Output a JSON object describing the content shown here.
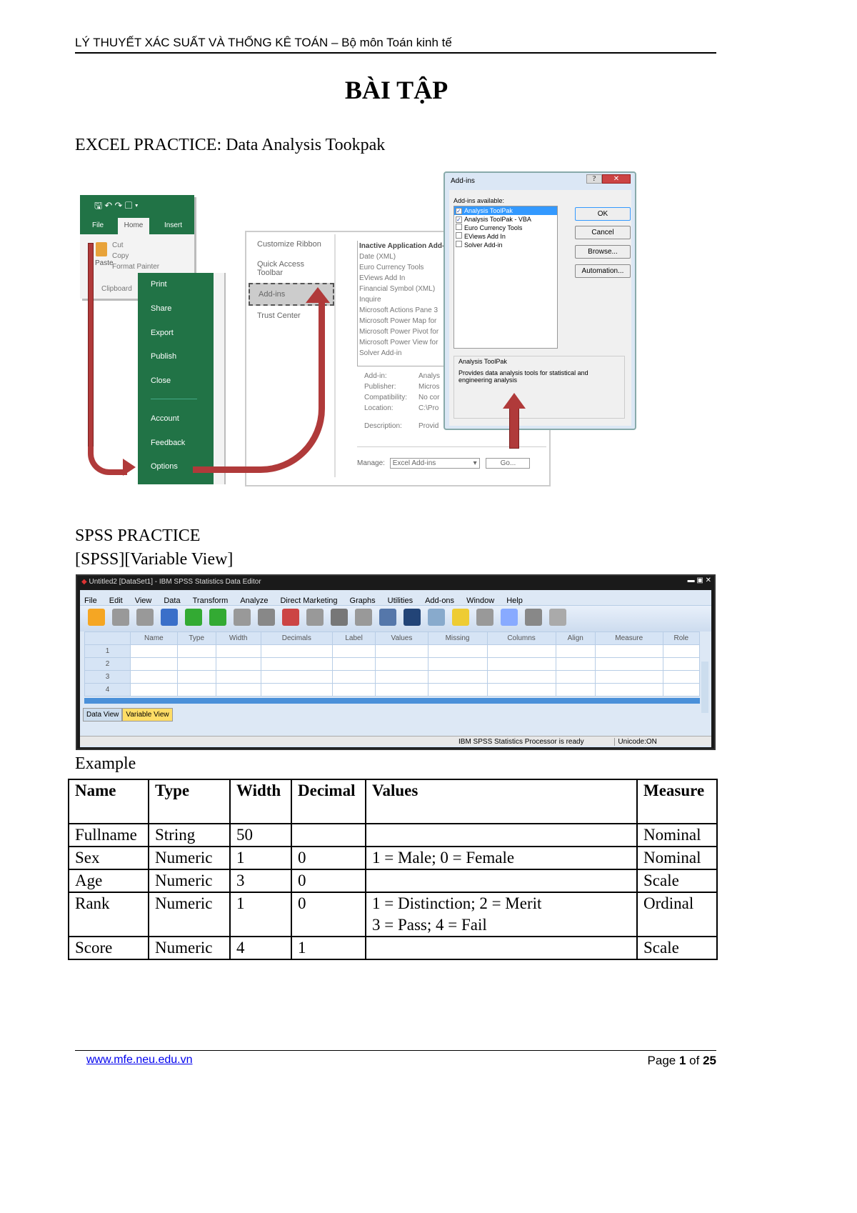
{
  "header": "LÝ THUYẾT XÁC SUẤT VÀ THỐNG KÊ TOÁN – Bộ môn Toán kinh tế",
  "title": "BÀI TẬP",
  "excel_heading": "EXCEL PRACTICE: Data Analysis Tookpak",
  "excel": {
    "tabs": [
      "File",
      "Home",
      "Insert"
    ],
    "ribbon": [
      "Cut",
      "Copy",
      "Format Painter",
      "Clipboard",
      "Paste"
    ],
    "backstage": [
      "Print",
      "Share",
      "Export",
      "Publish",
      "Close",
      "Account",
      "Feedback",
      "Options"
    ],
    "options_nav": [
      "Customize Ribbon",
      "Quick Access Toolbar",
      "Add-ins",
      "Trust Center"
    ],
    "inactive_title": "Inactive Application Add-ins",
    "inactive": [
      "Date (XML)",
      "Euro Currency Tools",
      "EViews Add In",
      "Financial Symbol (XML)",
      "Inquire",
      "Microsoft Actions Pane 3",
      "Microsoft Power Map for",
      "Microsoft Power Pivot for",
      "Microsoft Power View for",
      "Solver Add-in"
    ],
    "details": [
      [
        "Add-in:",
        "Analys"
      ],
      [
        "Publisher:",
        "Micros"
      ],
      [
        "Compatibility:",
        "No cor"
      ],
      [
        "Location:",
        "C:\\Pro"
      ],
      [
        "Description:",
        "Provid"
      ]
    ],
    "manage_label": "Manage:",
    "manage_value": "Excel Add-ins",
    "go": "Go...",
    "dialog": {
      "title": "Add-ins",
      "available": "Add-ins available:",
      "items": [
        {
          "label": "Analysis ToolPak",
          "checked": true
        },
        {
          "label": "Analysis ToolPak - VBA",
          "checked": true
        },
        {
          "label": "Euro Currency Tools",
          "checked": false
        },
        {
          "label": "EViews Add In",
          "checked": false
        },
        {
          "label": "Solver Add-in",
          "checked": false
        }
      ],
      "buttons": [
        "OK",
        "Cancel",
        "Browse...",
        "Automation..."
      ],
      "desc_title": "Analysis ToolPak",
      "desc": "Provides data analysis tools for statistical and engineering analysis"
    }
  },
  "spss_heading": "SPSS PRACTICE",
  "spss_sub": "[SPSS][Variable View]",
  "spss": {
    "title": "Untitled2 [DataSet1] - IBM SPSS Statistics Data Editor",
    "menu": [
      "File",
      "Edit",
      "View",
      "Data",
      "Transform",
      "Analyze",
      "Direct Marketing",
      "Graphs",
      "Utilities",
      "Add-ons",
      "Window",
      "Help"
    ],
    "columns": [
      "Name",
      "Type",
      "Width",
      "Decimals",
      "Label",
      "Values",
      "Missing",
      "Columns",
      "Align",
      "Measure",
      "Role"
    ],
    "rows": [
      "1",
      "2",
      "3",
      "4"
    ],
    "tabs": [
      "Data View",
      "Variable View"
    ],
    "status": "IBM SPSS Statistics Processor is ready",
    "unicode": "Unicode:ON"
  },
  "example_label": "Example",
  "example": {
    "headers": [
      "Name",
      "Type",
      "Width",
      "Decimal",
      "Values",
      "Measure"
    ],
    "rows": [
      [
        "Fullname",
        "String",
        "50",
        "",
        "",
        "Nominal"
      ],
      [
        "Sex",
        "Numeric",
        "1",
        "0",
        "1 = Male; 0 = Female",
        "Nominal"
      ],
      [
        "Age",
        "Numeric",
        "3",
        "0",
        "",
        "Scale"
      ],
      [
        "Rank",
        "Numeric",
        "1",
        "0",
        "1 = Distinction; 2 = Merit\n3 = Pass; 4 = Fail",
        "Ordinal"
      ],
      [
        "Score",
        "Numeric",
        "4",
        "1",
        "",
        "Scale"
      ]
    ]
  },
  "footer": {
    "link": "www.mfe.neu.edu.vn",
    "page_prefix": "Page ",
    "page": "1",
    "of": " of ",
    "total": "25"
  }
}
